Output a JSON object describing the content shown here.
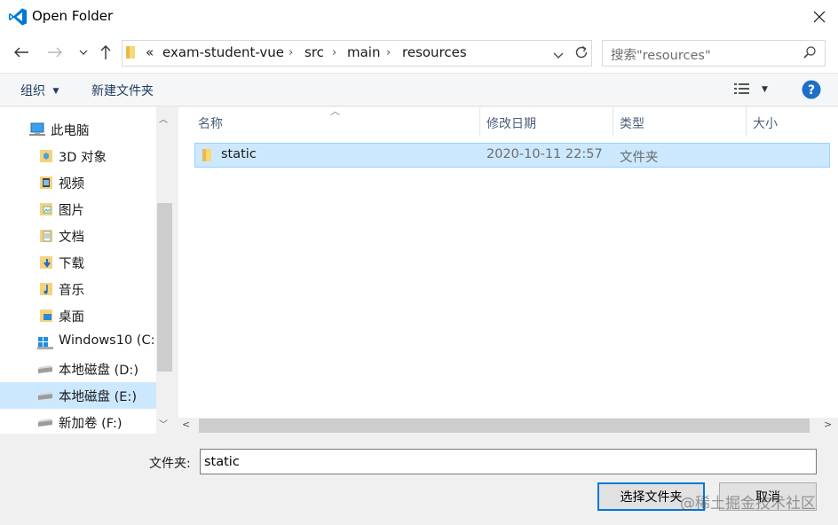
{
  "window": {
    "title": "Open Folder"
  },
  "nav": {
    "breadcrumb_prefix": "«",
    "breadcrumbs": [
      "exam-student-vue",
      "src",
      "main",
      "resources"
    ],
    "search_placeholder": "搜索\"resources\""
  },
  "toolbar": {
    "organize_label": "组织",
    "new_folder_label": "新建文件夹"
  },
  "sidebar": {
    "items": [
      {
        "label": "此电脑",
        "icon": "computer-icon"
      },
      {
        "label": "3D 对象",
        "icon": "3d-objects-icon"
      },
      {
        "label": "视频",
        "icon": "video-folder-icon"
      },
      {
        "label": "图片",
        "icon": "pictures-folder-icon"
      },
      {
        "label": "文档",
        "icon": "documents-folder-icon"
      },
      {
        "label": "下载",
        "icon": "downloads-folder-icon"
      },
      {
        "label": "音乐",
        "icon": "music-folder-icon"
      },
      {
        "label": "桌面",
        "icon": "desktop-folder-icon"
      },
      {
        "label": "Windows10 (C:",
        "icon": "windows-drive-icon"
      },
      {
        "label": "本地磁盘 (D:)",
        "icon": "drive-icon"
      },
      {
        "label": "本地磁盘 (E:)",
        "icon": "drive-icon",
        "selected": true
      },
      {
        "label": "新加卷 (F:)",
        "icon": "drive-icon"
      }
    ]
  },
  "file_list": {
    "columns": [
      "名称",
      "修改日期",
      "类型",
      "大小"
    ],
    "rows": [
      {
        "name": "static",
        "modified": "2020-10-11 22:57",
        "type": "文件夹",
        "size": ""
      }
    ]
  },
  "bottom": {
    "folder_label": "文件夹:",
    "folder_value": "static",
    "select_button": "选择文件夹",
    "cancel_button": "取消"
  },
  "watermark": "@稀土掘金技术社区",
  "colors": {
    "accent": "#0078d7",
    "selection": "#cce8ff",
    "help_blue": "#1e6fc7",
    "vscode_blue": "#0065a9"
  }
}
